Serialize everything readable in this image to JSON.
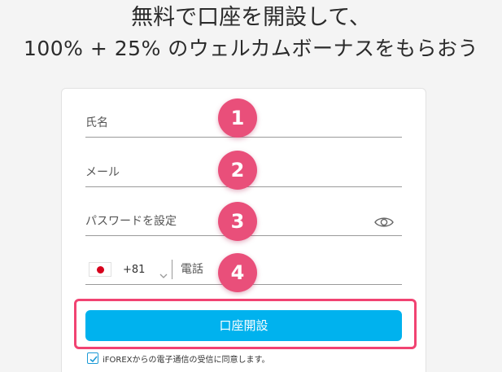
{
  "headline": {
    "line1": "無料で口座を開設して、",
    "line2": "100% + 25% のウェルカムボーナスをもらおう"
  },
  "form": {
    "name_placeholder": "氏名",
    "email_placeholder": "メール",
    "password_placeholder": "パスワードを設定",
    "country_code": "+81",
    "phone_placeholder": "電話",
    "submit_label": "口座開設",
    "consent_text": "iFOREXからの電子通信の受信に同意します。",
    "consent_checked": true
  },
  "badges": [
    "1",
    "2",
    "3",
    "4"
  ],
  "colors": {
    "badge": "#e94f7a",
    "highlight": "#f14372",
    "submit": "#00b2ee",
    "flag_sun": "#d7001c"
  },
  "icons": {
    "password_toggle": "eye-icon",
    "country_flag": "japan-flag-icon",
    "country_dropdown": "chevron-down-icon",
    "consent": "checkmark-icon"
  }
}
